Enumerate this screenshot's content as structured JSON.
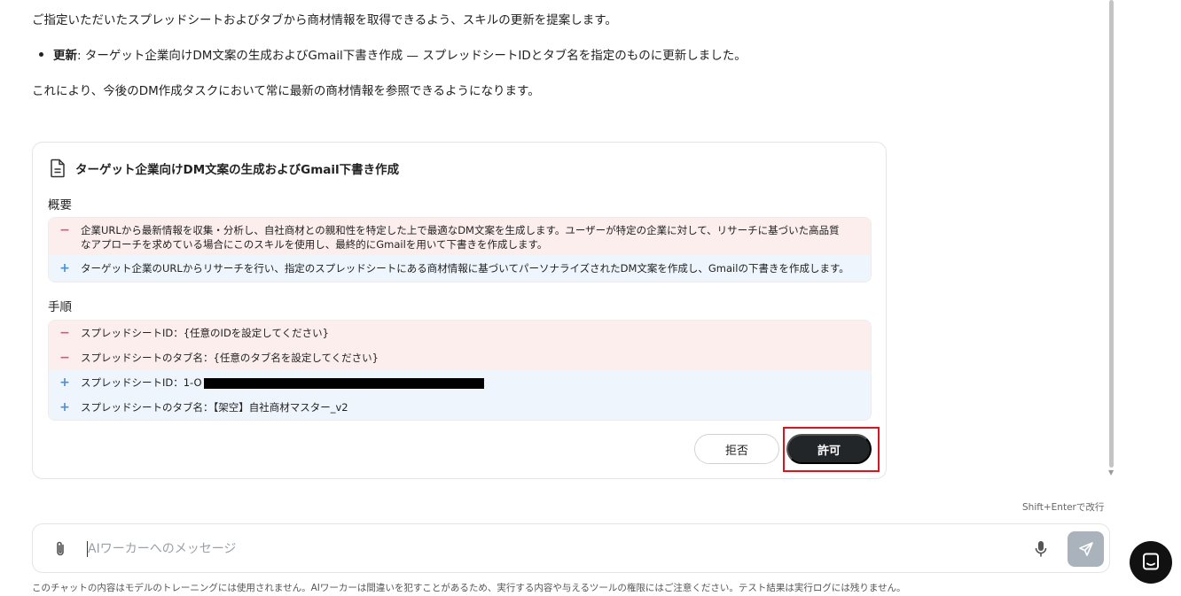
{
  "message": {
    "intro": "ご指定いただいたスプレッドシートおよびタブから商材情報を取得できるよう、スキルの更新を提案します。",
    "bullet_label": "更新",
    "bullet_text": ": ターゲット企業向けDM文案の生成およびGmail下書き作成 — スプレッドシートIDとタブ名を指定のものに更新しました。",
    "conclusion": "これにより、今後のDM作成タスクにおいて常に最新の商材情報を参照できるようになります。"
  },
  "card": {
    "icon": "document-icon",
    "title": "ターゲット企業向けDM文案の生成およびGmail下書き作成",
    "overview_label": "概要",
    "overview_removed_1": "企業URLから最新情報を収集・分析し、自社商材との親和性を特定した上で最適なDM文案を生成します。ユーザーが特定の企業に対して、リサーチに基づいた高品質",
    "overview_removed_2": "なアプローチを求めている場合にこのスキルを使用し、最終的にGmailを用いて下書きを作成します。",
    "overview_added": "ターゲット企業のURLからリサーチを行い、指定のスプレッドシートにある商材情報に基づいてパーソナライズされたDM文案を作成し、Gmailの下書きを作成します。",
    "steps_label": "手順",
    "steps_removed": [
      "スプレッドシートID：{任意のIDを設定してください}",
      "スプレッドシートのタブ名：{任意のタブ名を設定してください}"
    ],
    "steps_added_id_prefix": "スプレッドシートID：1-O",
    "steps_added_tab": "スプレッドシートのタブ名：【架空】自社商材マスター_v2",
    "deny_label": "拒否",
    "allow_label": "許可",
    "minus_sign": "−",
    "plus_sign": "+"
  },
  "composer": {
    "hint": "Shift+Enterで改行",
    "placeholder": "AIワーカーへのメッセージ",
    "value": ""
  },
  "footer_note": "このチャットの内容はモデルのトレーニングには使用されません。AIワーカーは間違いを犯すことがあるため、実行する内容や与えるツールの権限にはご注意ください。テスト結果は実行ログには残りません。",
  "colors": {
    "removed_bg": "#fdeeee",
    "added_bg": "#eef5fd",
    "allow_button": "#222629",
    "highlight": "#d9141e"
  }
}
